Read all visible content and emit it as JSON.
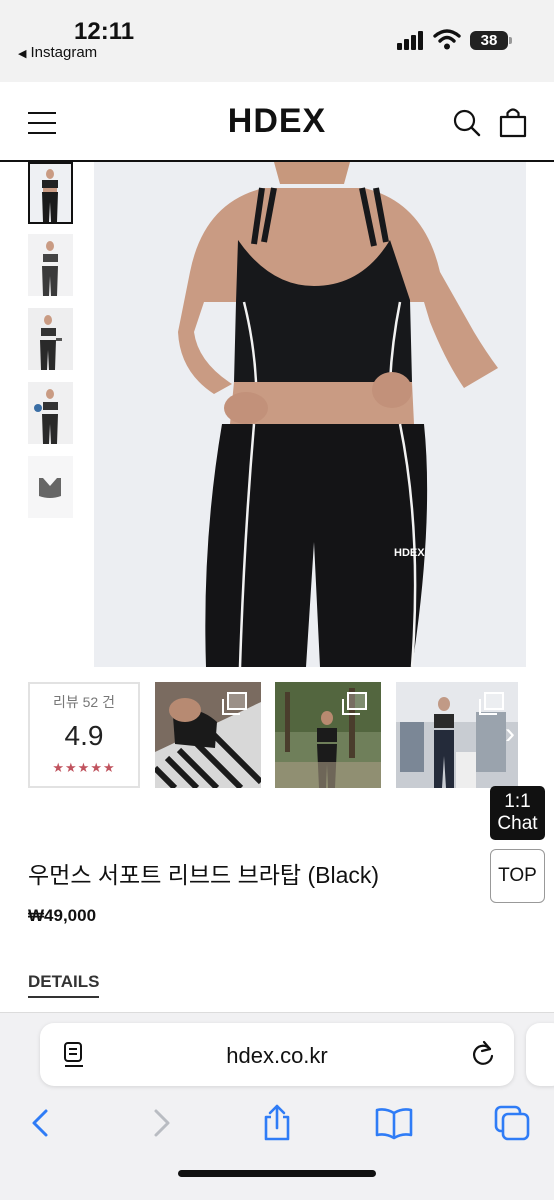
{
  "status_bar": {
    "time": "12:11",
    "back_app": "Instagram",
    "battery": "38"
  },
  "header": {
    "logo": "HDEX",
    "menu_icon": "hamburger-menu-icon",
    "search_icon": "search-icon",
    "cart_icon": "shopping-bag-icon"
  },
  "gallery": {
    "thumbnail_count": 5,
    "active_thumbnail": 1
  },
  "reviews": {
    "label": "리뷰 52 건",
    "score": "4.9",
    "stars": "★★★★★",
    "star_color": "#c0535e",
    "photo_count": 3
  },
  "floating": {
    "chat_line1": "1:1",
    "chat_line2": "Chat",
    "top_label": "TOP"
  },
  "product": {
    "title": "우먼스 서포트 리브드 브라탑 (Black)",
    "price": "₩49,000",
    "details_tab": "DETAILS"
  },
  "browser": {
    "url": "hdex.co.kr",
    "reader_icon": "reader-mode-icon",
    "reload_icon": "reload-icon",
    "back_icon": "back-arrow-icon",
    "forward_icon": "forward-arrow-icon",
    "share_icon": "share-icon",
    "bookmarks_icon": "bookmarks-icon",
    "tabs_icon": "tabs-icon",
    "accent_color": "#2f7cf6"
  }
}
